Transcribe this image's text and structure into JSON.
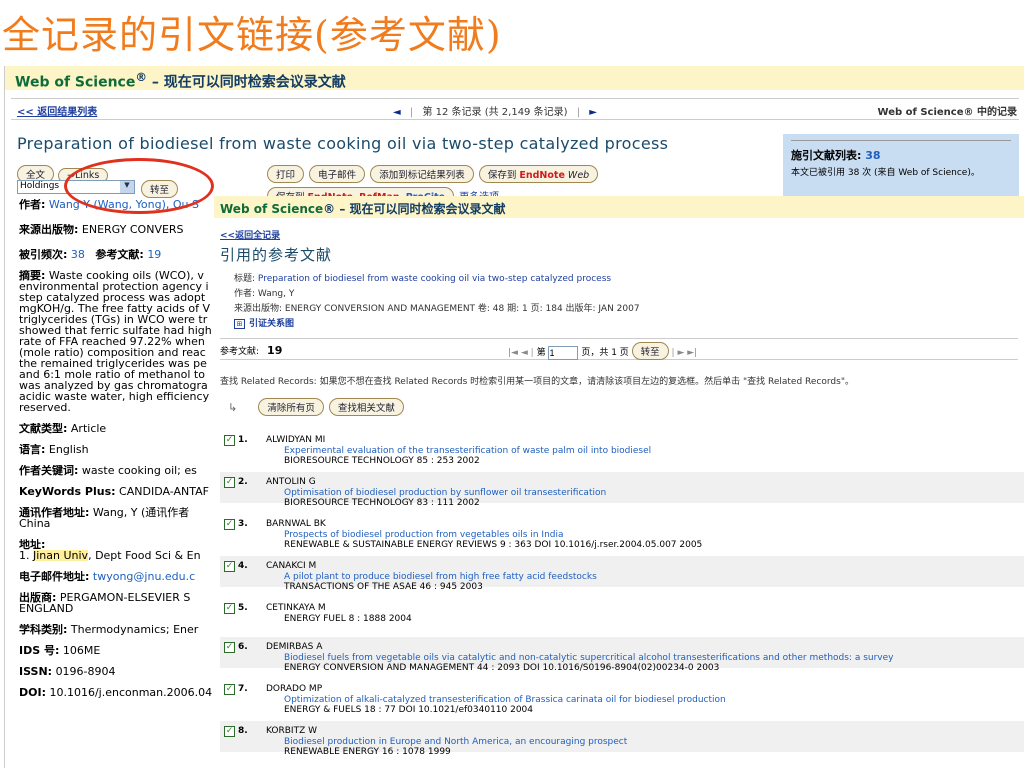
{
  "slide": {
    "title": "全记录的引文链接(参考文献)"
  },
  "bg": {
    "header_brand": "Web of Science",
    "header_sup": "®",
    "header_text": " – 现在可以同时检索会议录文献",
    "back_link": "<< 返回结果列表",
    "record_nav": "第 12 条记录 (共 2,149 条记录)",
    "nav_right": "Web of Science® 中的记录",
    "record_title": "Preparation of biodiesel from waste cooking oil via two-step catalyzed process",
    "fulltext_btn": "全文",
    "links_btn": "→Links",
    "holdings_value": "Holdings",
    "goto_btn": "转至",
    "print_btn": "打印",
    "email_btn": "电子邮件",
    "add_marked_btn": "添加到标记结果列表",
    "save_btn": "保存到",
    "save_endnote": "EndNote",
    "save_web": "Web",
    "save_to2": "保存到",
    "save_endnote2": "EndNote",
    "save_refman": "RefMan",
    "save_procite": "ProCite",
    "more_options": "更多选项",
    "cite_box_label": "施引文献列表:",
    "cite_box_count": "38",
    "cite_box_text": "本文已被引用 38 次 (来自 Web of Science)。",
    "fields": [
      {
        "label": "作者:",
        "value": "Wang Y (Wang, Yong), Ou S"
      },
      {
        "label": "来源出版物:",
        "value": "ENERGY CONVERS"
      },
      {
        "label": "被引频次:",
        "value": "38",
        "label2": "参考文献:",
        "value2": "19"
      },
      {
        "label": "摘要:",
        "value": "Waste cooking oils (WCO), v"
      }
    ],
    "abstract_lines": [
      "environmental protection agency i",
      "step catalyzed process was adopt",
      "mgKOH/g. The free fatty acids of V",
      "triglycerides (TGs) in WCO were tr",
      "showed that ferric sulfate had high",
      "rate of FFA reached 97.22% when",
      "(mole ratio) composition and reac",
      "the remained triglycerides was pe",
      "and 6:1 mole ratio of methanol to",
      "was analyzed by gas chromatogra",
      "acidic waste water, high efficiency",
      "reserved."
    ],
    "doc_type_label": "文献类型:",
    "doc_type": "Article",
    "lang_label": "语言:",
    "lang": "English",
    "kw_label": "作者关键词:",
    "kw": "waste cooking oil; es",
    "kwplus_label": "KeyWords Plus:",
    "kwplus": "CANDIDA-ANTAF",
    "corr_label": "通讯作者地址:",
    "corr": "Wang, Y (通讯作者",
    "corr2": "China",
    "addr_label": "地址:",
    "addr_num": "1.",
    "addr_hl": "Jinan Univ",
    "addr_rest": ", Dept Food Sci & En",
    "email_label": "电子邮件地址:",
    "email": "twyong@jnu.edu.c",
    "pub_label": "出版商:",
    "pub": "PERGAMON-ELSEVIER S",
    "pub2": "ENGLAND",
    "subj_label": "学科类别:",
    "subj": "Thermodynamics; Ener",
    "ids_label": "IDS 号:",
    "ids": "106ME",
    "issn_label": "ISSN:",
    "issn": "0196-8904",
    "doi_label": "DOI:",
    "doi": "10.1016/j.enconman.2006.04"
  },
  "fg": {
    "header_brand": "Web of Science",
    "header_sup": "®",
    "header_text": " – 现在可以同时检索会议录文献",
    "back_link": "<<返回全记录",
    "title": "引用的参考文献",
    "meta_title_label": "标题:",
    "meta_title": "Preparation of biodiesel from waste cooking oil via two-step catalyzed process",
    "meta_author": "作者: Wang, Y",
    "meta_source": "来源出版物: ENERGY CONVERSION AND MANAGEMENT 卷: 48 期: 1 页: 184 出版年: JAN 2007",
    "citation_map": "引证关系图",
    "refs_label": "参考文献:",
    "refs_count": "19",
    "page_prefix": "第",
    "page_value": "1",
    "page_suffix": "页，共 1 页",
    "goto_btn": "转至",
    "instructions": "查找 Related Records: 如果您不想在查找 Related Records 时检索引用某一项目的文章，请清除该项目左边的复选框。然后单击 \"查找 Related Records\"。",
    "clear_btn": "清除所有页",
    "find_related_btn": "查找相关文献",
    "refs": [
      {
        "num": "1.",
        "author": "ALWIDYAN MI",
        "title": "Experimental evaluation of the transesterification of waste palm oil into biodiesel",
        "source": "BIORESOURCE TECHNOLOGY 85 : 253 2002"
      },
      {
        "num": "2.",
        "author": "ANTOLIN G",
        "title": "Optimisation of biodiesel production by sunflower oil transesterification",
        "source": "BIORESOURCE TECHNOLOGY 83 : 111 2002"
      },
      {
        "num": "3.",
        "author": "BARNWAL BK",
        "title": "Prospects of biodiesel production from vegetables oils in India",
        "source": "RENEWABLE & SUSTAINABLE ENERGY REVIEWS 9 : 363 DOI 10.1016/j.rser.2004.05.007 2005"
      },
      {
        "num": "4.",
        "author": "CANAKCI M",
        "title": "A pilot plant to produce biodiesel from high free fatty acid feedstocks",
        "source": "TRANSACTIONS OF THE ASAE 46 : 945 2003"
      },
      {
        "num": "5.",
        "author": "CETINKAYA M",
        "title": "",
        "source": "ENERGY FUEL 8 : 1888 2004"
      },
      {
        "num": "6.",
        "author": "DEMIRBAS A",
        "title": "Biodiesel fuels from vegetable oils via catalytic and non-catalytic supercritical alcohol transesterifications and other methods: a survey",
        "source": "ENERGY CONVERSION AND MANAGEMENT 44 : 2093 DOI 10.1016/S0196-8904(02)00234-0 2003"
      },
      {
        "num": "7.",
        "author": "DORADO MP",
        "title": "Optimization of alkali-catalyzed transesterification of Brassica carinata oil for biodiesel production",
        "source": "ENERGY & FUELS 18 : 77 DOI 10.1021/ef0340110 2004"
      },
      {
        "num": "8.",
        "author": "KORBITZ W",
        "title": "Biodiesel production in Europe and North America, an encouraging prospect",
        "source": "RENEWABLE ENERGY 16 : 1078 1999"
      }
    ]
  }
}
